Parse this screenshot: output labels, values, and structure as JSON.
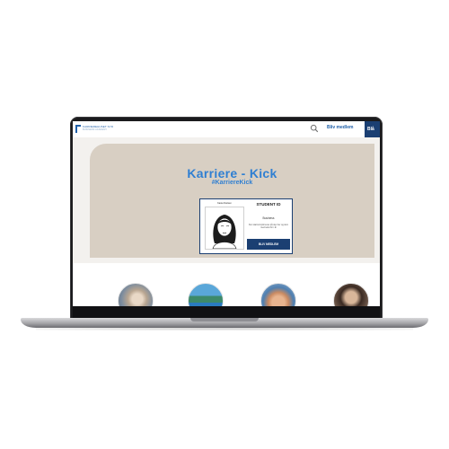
{
  "header": {
    "logo_line1": "KARRIEREHUSET SYD",
    "logo_line2": "BUSINESS ACADEMY",
    "search_icon": "search-icon",
    "cta_label": "Bliv medlem",
    "login_label": "Blå"
  },
  "hero": {
    "title": "Karriere - Kick",
    "hashtag": "#KarriereKick"
  },
  "id_card": {
    "name": "Kasia Nielsen",
    "heading": "STUDENT ID",
    "field": "Business",
    "note": "Der skal komprimeres på den her og dem med tekst for i år",
    "button_label": "BLIV MEDLEM"
  },
  "photos": [
    "person-photo",
    "beach-photo",
    "hands-photo",
    "portrait-photo"
  ],
  "colors": {
    "brand_blue": "#2f7fd2",
    "navy": "#1b3f72",
    "hero_beige": "#d8cfc3"
  }
}
